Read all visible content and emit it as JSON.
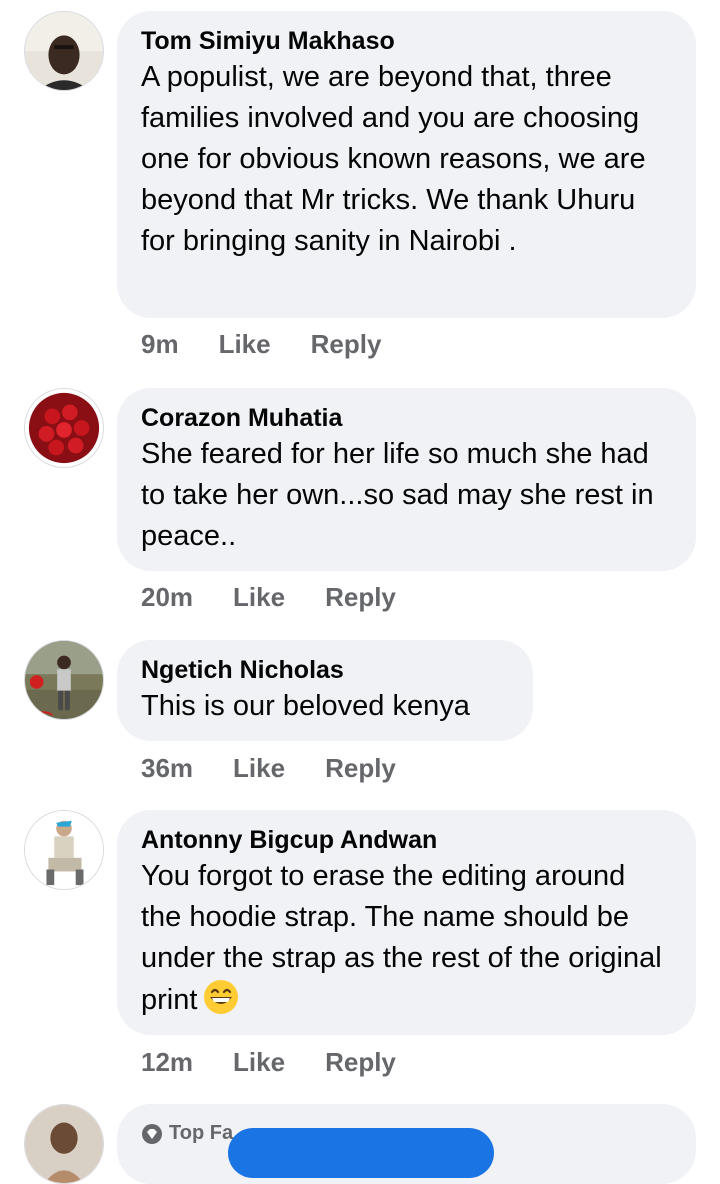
{
  "comments": [
    {
      "author": "Tom Simiyu Makhaso",
      "text": "A populist, we are beyond that, three families involved and you are choosing one for obvious known reasons, we are beyond that Mr tricks. We thank Uhuru for bringing sanity in Nairobi .",
      "time": "9m",
      "like_label": "Like",
      "reply_label": "Reply"
    },
    {
      "author": "Corazon Muhatia",
      "text": "She feared for her life so much she had to take her own...so sad may she rest in peace..",
      "time": "20m",
      "like_label": "Like",
      "reply_label": "Reply"
    },
    {
      "author": "Ngetich Nicholas",
      "text": "This is our beloved kenya",
      "time": "36m",
      "like_label": "Like",
      "reply_label": "Reply"
    },
    {
      "author": "Antonny Bigcup Andwan",
      "text": "You forgot to erase the editing around the hoodie strap. The name should be under the strap as the rest of the original print",
      "emoji": "grinning-face-icon",
      "time": "12m",
      "like_label": "Like",
      "reply_label": "Reply"
    }
  ],
  "partial_comment": {
    "badge_label": "Top Fa",
    "badge_icon": "top-fan-diamond-icon"
  },
  "colors": {
    "bubble": "#f0f2f5",
    "meta": "#65676b",
    "accent": "#1b74e4"
  }
}
